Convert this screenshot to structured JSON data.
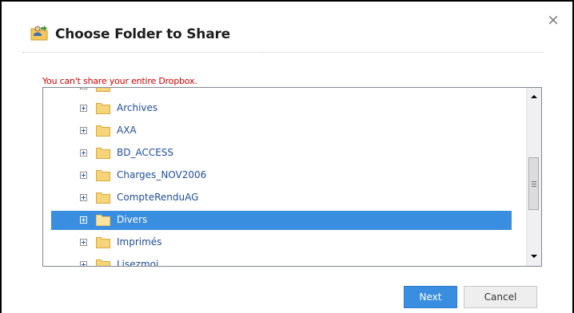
{
  "dialog": {
    "title": "Choose Folder to Share",
    "close_glyph": "×",
    "error_message": "You can't share your entire Dropbox.",
    "title_icon": "share-folder-icon",
    "colors": {
      "accent": "#3a8ee0",
      "error": "#d20000",
      "folder": "#f4cf6e",
      "link_text": "#1f4e9a"
    }
  },
  "tree": {
    "items": [
      {
        "label": "",
        "partial": true
      },
      {
        "label": "Archives"
      },
      {
        "label": "AXA"
      },
      {
        "label": "BD_ACCESS"
      },
      {
        "label": "Charges_NOV2006"
      },
      {
        "label": "CompteRenduAG"
      },
      {
        "label": "Divers",
        "selected": true
      },
      {
        "label": "Imprimés"
      },
      {
        "label": "Lisezmoi",
        "partial": true
      }
    ]
  },
  "buttons": {
    "next": "Next",
    "cancel": "Cancel"
  }
}
